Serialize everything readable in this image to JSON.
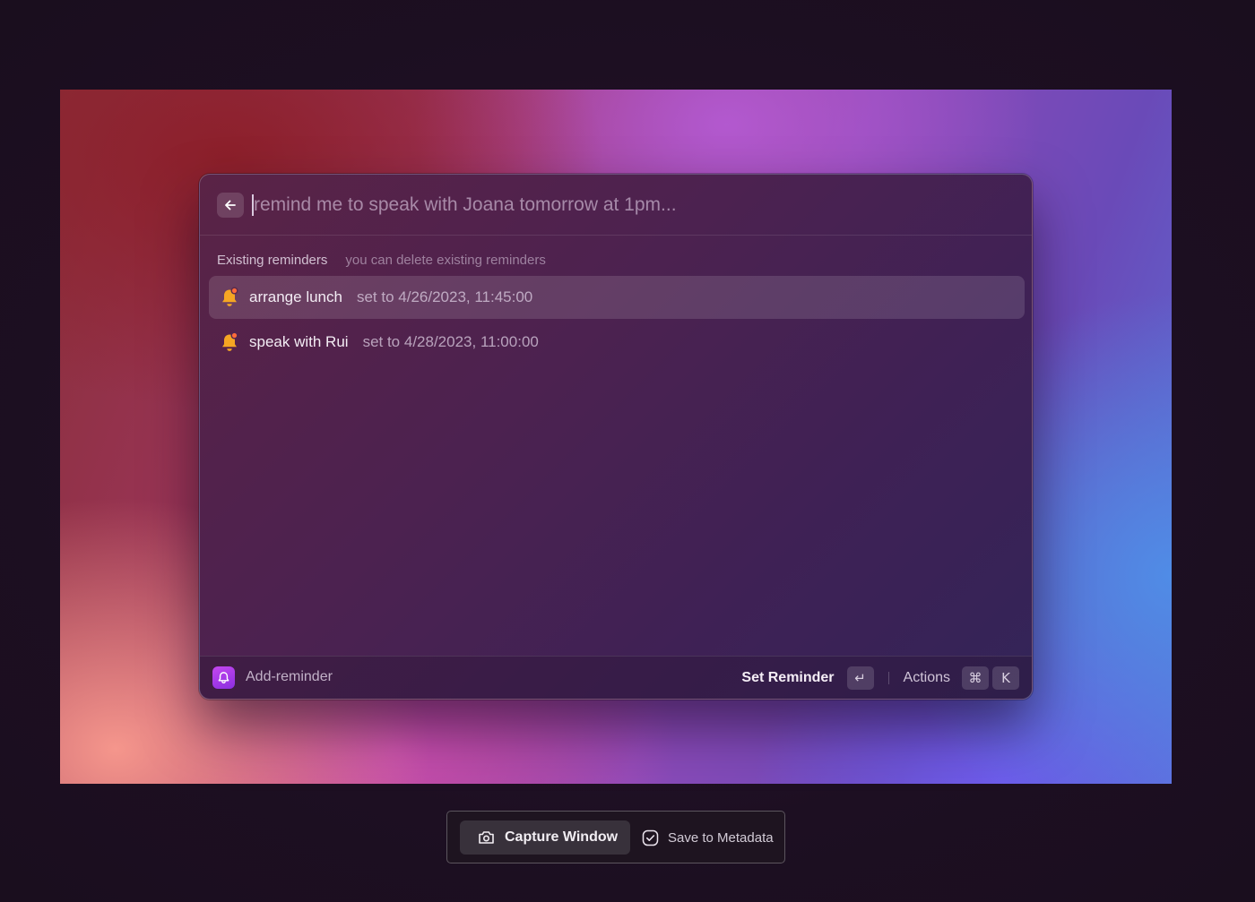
{
  "search": {
    "placeholder": "remind me to speak with Joana tomorrow at 1pm..."
  },
  "section": {
    "title": "Existing reminders",
    "subtitle": "you can delete existing reminders"
  },
  "reminders": [
    {
      "title": "arrange lunch",
      "subtitle": "set to 4/26/2023, 11:45:00",
      "icon": "bell-icon",
      "selected": true
    },
    {
      "title": "speak with Rui",
      "subtitle": "set to 4/28/2023, 11:00:00",
      "icon": "bell-icon",
      "selected": false
    }
  ],
  "footer": {
    "extension_name": "Add-reminder",
    "primary_action": "Set Reminder",
    "primary_key": "↵",
    "actions_label": "Actions",
    "actions_keys": [
      "⌘",
      "K"
    ]
  },
  "capture": {
    "capture_label": "Capture Window",
    "save_label": "Save to Metadata"
  },
  "colors": {
    "bell": "#f5a623",
    "extension_icon": "#b03de9"
  }
}
